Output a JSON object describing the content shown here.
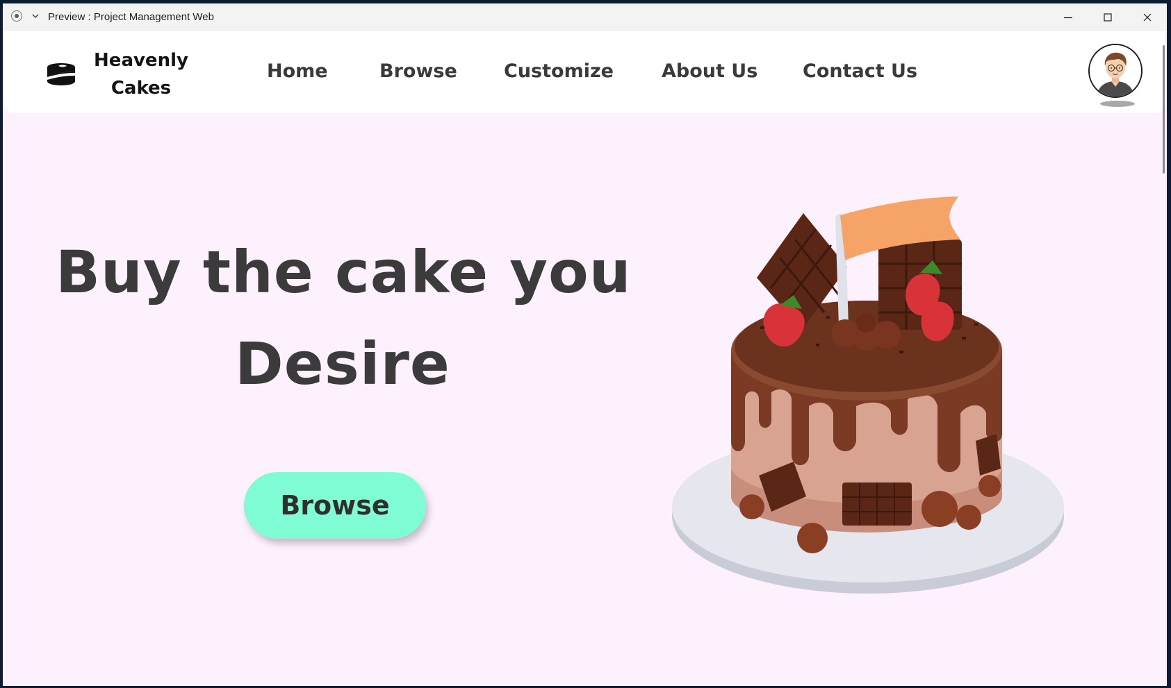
{
  "window": {
    "title": "Preview : Project Management Web",
    "controls": [
      "minimize-icon",
      "maximize-icon",
      "close-icon"
    ]
  },
  "nav": {
    "brand_line1": "Heavenly",
    "brand_line2": "Cakes",
    "links": [
      "Home",
      "Browse",
      "Customize",
      "About Us",
      "Contact Us"
    ]
  },
  "hero": {
    "headline_line1": "Buy the cake you",
    "headline_line2": "Desire",
    "cta_label": "Browse"
  },
  "colors": {
    "page_background": "#fdf1fd",
    "nav_background": "#ffffff",
    "cta_background": "#7ffcd3",
    "text_dark": "#3b3b3b"
  },
  "icons": {
    "logo": "cake-logo-icon",
    "avatar": "user-avatar-icon",
    "hero_image": "chocolate-cake-illustration"
  }
}
